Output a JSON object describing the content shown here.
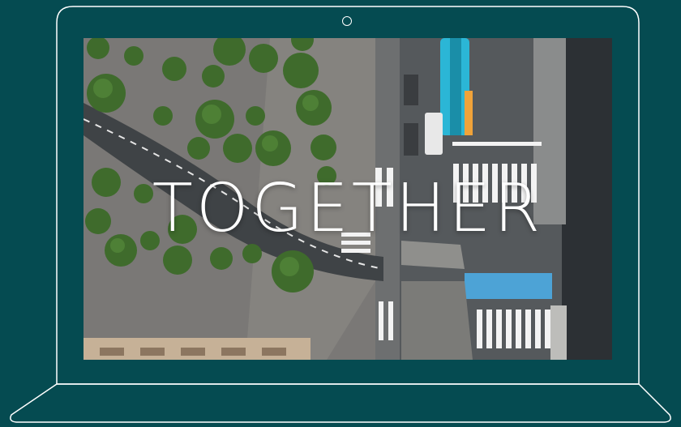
{
  "hero": {
    "headline": "TOGETHER"
  },
  "colors": {
    "background": "#054b51",
    "outline": "#ffffff",
    "tram": "#2bb6d6",
    "crosswalk": "#f3f3f3",
    "bike_lane": "#4da3d6"
  },
  "illustration": {
    "device": "laptop-outline-icon",
    "screen_content": "aerial-city-intersection-photo"
  }
}
